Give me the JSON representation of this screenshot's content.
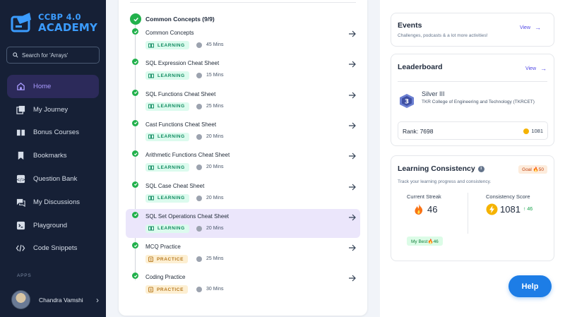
{
  "logo": {
    "line1": "CCBP 4.0",
    "line2": "ACADEMY"
  },
  "search": {
    "placeholder": "Search for 'Arrays'"
  },
  "nav": [
    {
      "label": "Home",
      "icon": "home-icon",
      "active": true
    },
    {
      "label": "My Journey",
      "icon": "journey-icon"
    },
    {
      "label": "Bonus Courses",
      "icon": "book-icon"
    },
    {
      "label": "Bookmarks",
      "icon": "bookmark-icon"
    },
    {
      "label": "Question Bank",
      "icon": "question-bank-icon"
    },
    {
      "label": "My Discussions",
      "icon": "discussion-icon"
    },
    {
      "label": "Playground",
      "icon": "terminal-icon"
    },
    {
      "label": "Code Snippets",
      "icon": "code-icon"
    }
  ],
  "apps_label": "APPS",
  "user": {
    "name": "Chandra Vamshi"
  },
  "section": {
    "title": "Common Concepts (9/9)"
  },
  "items": [
    {
      "title": "Common Concepts",
      "type": "LEARNING",
      "duration": "45 Mins"
    },
    {
      "title": "SQL Expression Cheat Sheet",
      "type": "LEARNING",
      "duration": "15 Mins"
    },
    {
      "title": "SQL Functions Cheat Sheet",
      "type": "LEARNING",
      "duration": "25 Mins"
    },
    {
      "title": "Cast Functions Cheat Sheet",
      "type": "LEARNING",
      "duration": "20 Mins"
    },
    {
      "title": "Arithmetic Functions Cheat Sheet",
      "type": "LEARNING",
      "duration": "20 Mins"
    },
    {
      "title": "SQL Case Cheat Sheet",
      "type": "LEARNING",
      "duration": "20 Mins"
    },
    {
      "title": "SQL Set Operations Cheat Sheet",
      "type": "LEARNING",
      "duration": "20 Mins",
      "active": true
    },
    {
      "title": "MCQ Practice",
      "type": "PRACTICE",
      "duration": "25 Mins"
    },
    {
      "title": "Coding Practice",
      "type": "PRACTICE",
      "duration": "30 Mins"
    }
  ],
  "events": {
    "title": "Events",
    "subtitle": "Challenges, podcasts & a lot more activities!",
    "view": "View"
  },
  "leaderboard": {
    "title": "Leaderboard",
    "view": "View",
    "tier": "Silver III",
    "tier_number": "3",
    "college": "TKR College of Engineering and Technology (TKRCET)",
    "rank": "Rank: 7698",
    "coins": "1081"
  },
  "consistency": {
    "title": "Learning Consistency",
    "goal": "Goal 🔥50",
    "subtitle": "Track your learning progress and consistency.",
    "streak_label": "Current Streak",
    "streak": "46",
    "best": "My Best🔥46",
    "score_label": "Consistency Score",
    "score": "1081",
    "score_delta": "↑ 46"
  },
  "help": "Help",
  "colors": {
    "accent": "#4f46e5",
    "success": "#22b14c",
    "sidebar_bg": "#162036",
    "help_btn": "#1d7de6"
  }
}
